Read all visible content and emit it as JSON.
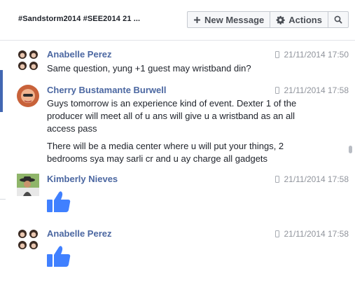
{
  "header": {
    "thread_title": "#Sandstorm2014 #SEE2014  21 ...",
    "new_message_label": "New Message",
    "actions_label": "Actions"
  },
  "messages": [
    {
      "author": "Anabelle Perez",
      "timestamp": "21/11/2014 17:50",
      "lines": [
        "Same question, yung +1 guest may wristband din?"
      ],
      "avatar": "avatar-grid"
    },
    {
      "author": "Cherry Bustamante Burwell",
      "timestamp": "21/11/2014 17:58",
      "paragraph1": [
        "Guys tomorrow is an experience kind of event. Dexter 1 of the",
        "producer will meet all of u ans will give u a wristband as an all",
        "access pass"
      ],
      "paragraph2": [
        "There will be a media center where u will put your things, 2",
        "bedrooms sya may sarli cr and u ay charge all gadgets"
      ],
      "avatar": "avatar-photo"
    },
    {
      "author": "Kimberly Nieves",
      "timestamp": "21/11/2014 17:58",
      "sticker": "thumbs-up-icon",
      "avatar": "avatar-photo-hat"
    },
    {
      "author": "Anabelle Perez",
      "timestamp": "21/11/2014 17:58",
      "sticker": "thumbs-up-icon",
      "avatar": "avatar-grid"
    }
  ],
  "colors": {
    "author": "#4b67a1",
    "like": "#4080ff",
    "accent": "#4267b2"
  }
}
